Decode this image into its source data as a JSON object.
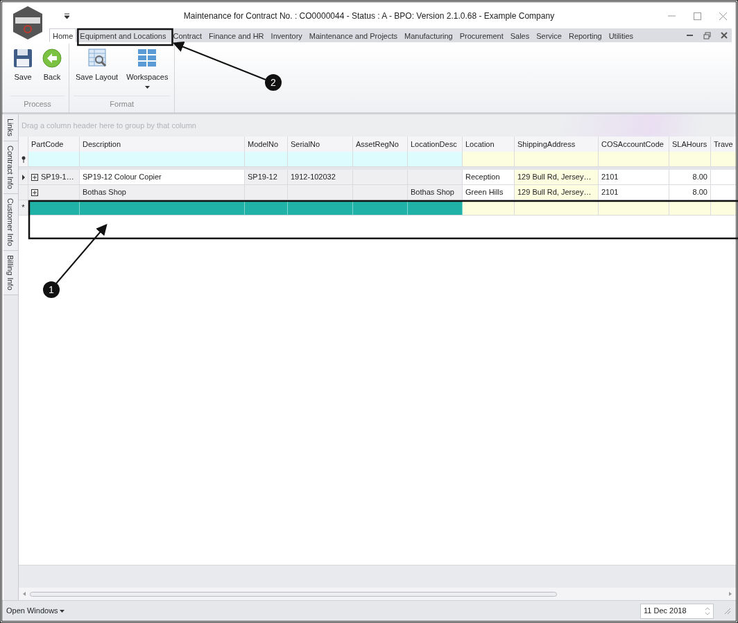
{
  "window": {
    "title": "Maintenance for Contract No. : CO0000044 - Status : A - BPO: Version 2.1.0.68 - Example Company"
  },
  "ribbon_tabs": [
    {
      "label": "Home",
      "selected": true
    },
    {
      "label": "Equipment and Locations",
      "selected": false
    },
    {
      "label": "Contract",
      "selected": false
    },
    {
      "label": "Finance and HR",
      "selected": false
    },
    {
      "label": "Inventory",
      "selected": false
    },
    {
      "label": "Maintenance and Projects",
      "selected": false
    },
    {
      "label": "Manufacturing",
      "selected": false
    },
    {
      "label": "Procurement",
      "selected": false
    },
    {
      "label": "Sales",
      "selected": false
    },
    {
      "label": "Service",
      "selected": false
    },
    {
      "label": "Reporting",
      "selected": false
    },
    {
      "label": "Utilities",
      "selected": false
    }
  ],
  "ribbon_groups": [
    {
      "label": "Process",
      "buttons": [
        {
          "label": "Save",
          "kind": "save"
        },
        {
          "label": "Back",
          "kind": "back"
        }
      ]
    },
    {
      "label": "Format",
      "buttons": [
        {
          "label": "Save Layout",
          "kind": "layout"
        },
        {
          "label": "Workspaces",
          "kind": "workspaces",
          "dropdown": true
        }
      ]
    }
  ],
  "side_tabs": [
    {
      "label": "Links"
    },
    {
      "label": "Contract Info"
    },
    {
      "label": "Customer Info"
    },
    {
      "label": "Billing Info"
    }
  ],
  "grid": {
    "group_hint": "Drag a column header here to group by that column",
    "columns": [
      {
        "label": "PartCode",
        "kind": "locked"
      },
      {
        "label": "Description",
        "kind": "locked"
      },
      {
        "label": "ModelNo",
        "kind": "locked"
      },
      {
        "label": "SerialNo",
        "kind": "locked"
      },
      {
        "label": "AssetRegNo",
        "kind": "locked"
      },
      {
        "label": "LocationDesc",
        "kind": "locked"
      },
      {
        "label": "Location",
        "kind": "edit"
      },
      {
        "label": "ShippingAddress",
        "kind": "lookup"
      },
      {
        "label": "COSAccountCode",
        "kind": "edit"
      },
      {
        "label": "SLAHours",
        "kind": "number"
      },
      {
        "label": "Trave",
        "kind": "edit"
      }
    ],
    "rows": [
      {
        "kind": "data",
        "selected": true,
        "expandable": true,
        "cells": [
          "SP19-1…",
          {
            "text": "SP19-12 Colour Copier",
            "focused": true
          },
          "SP19-12",
          "1912-102032",
          "",
          "",
          "Reception",
          "129 Bull Rd, Jersey…",
          "2101",
          "8.00",
          ""
        ]
      },
      {
        "kind": "data",
        "selected": false,
        "expandable": true,
        "cells": [
          "",
          "Bothas Shop",
          "",
          "",
          "",
          "Bothas Shop",
          "Green Hills",
          "129 Bull Rd, Jersey…",
          "2101",
          "8.00",
          ""
        ]
      },
      {
        "kind": "new",
        "selected": false,
        "expandable": false,
        "indicator": "*",
        "cells": [
          "",
          "",
          "",
          "",
          "",
          "",
          "",
          "",
          "",
          "",
          ""
        ]
      }
    ]
  },
  "status_bar": {
    "open_windows": "Open Windows",
    "date": "11 Dec 2018"
  },
  "annotations": [
    {
      "label": "1"
    },
    {
      "label": "2"
    }
  ]
}
